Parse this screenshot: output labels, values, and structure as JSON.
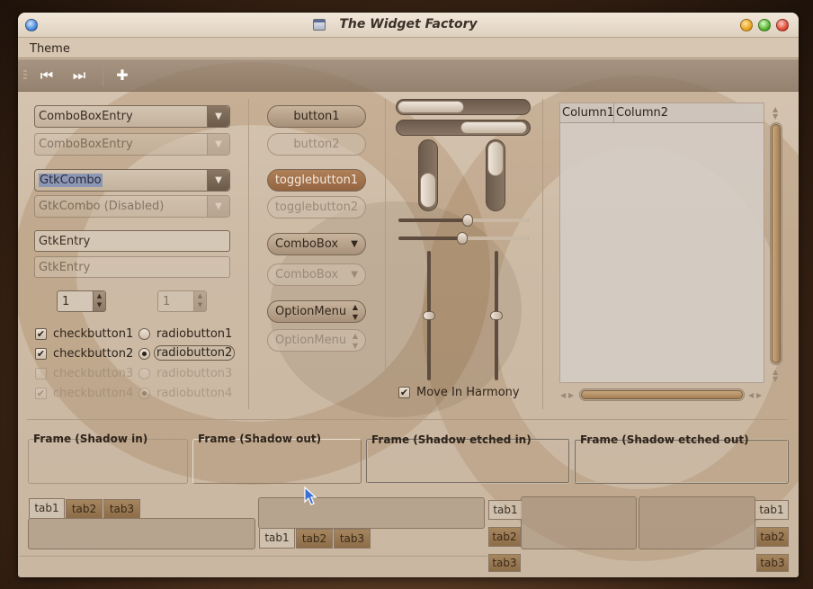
{
  "window": {
    "title": "The Widget Factory"
  },
  "menubar": {
    "items": [
      "Theme"
    ]
  },
  "toolbar": {
    "buttons": [
      {
        "name": "go-first",
        "icon": "go-first-icon",
        "glyph": "⏮"
      },
      {
        "name": "go-last",
        "icon": "go-last-icon",
        "glyph": "⏭"
      },
      {
        "name": "add",
        "icon": "add-icon",
        "glyph": "✚"
      }
    ]
  },
  "column1": {
    "combobox_entry": "ComboBoxEntry",
    "combobox_entry_disabled": "ComboBoxEntry",
    "gtk_combo": "GtkCombo",
    "gtk_combo_disabled": "GtkCombo (Disabled)",
    "gtk_entry": "GtkEntry",
    "gtk_entry_disabled": "GtkEntry",
    "spin_value": "1",
    "spin_value_disabled": "1",
    "checks": [
      {
        "label": "checkbutton1",
        "checked": true,
        "disabled": false
      },
      {
        "label": "checkbutton2",
        "checked": true,
        "disabled": false
      },
      {
        "label": "checkbutton3",
        "checked": false,
        "disabled": true
      },
      {
        "label": "checkbutton4",
        "checked": true,
        "disabled": true
      }
    ],
    "radios": [
      {
        "label": "radiobutton1",
        "selected": false,
        "disabled": false
      },
      {
        "label": "radiobutton2",
        "selected": true,
        "disabled": false
      },
      {
        "label": "radiobutton3",
        "selected": false,
        "disabled": true
      },
      {
        "label": "radiobutton4",
        "selected": true,
        "disabled": true
      }
    ]
  },
  "column2": {
    "button1": "button1",
    "button2": "button2",
    "togglebutton1": "togglebutton1",
    "togglebutton2": "togglebutton2",
    "combobox": "ComboBox",
    "combobox_disabled": "ComboBox",
    "optionmenu": "OptionMenu",
    "optionmenu_disabled": "OptionMenu"
  },
  "column3": {
    "progress_h1": 0.5,
    "progress_h2": 0.5,
    "progress_v1": 0.5,
    "progress_v2": 0.5,
    "scale_h1": 0.53,
    "scale_h2": 0.49,
    "scale_v1": 0.5,
    "scale_v2": 0.5,
    "move_in_harmony": "Move In Harmony",
    "move_in_harmony_checked": true
  },
  "treeview": {
    "columns": [
      "Column1",
      "Column2"
    ]
  },
  "frames": [
    {
      "label": "Frame (Shadow in)"
    },
    {
      "label": "Frame (Shadow out)"
    },
    {
      "label": "Frame (Shadow etched in)"
    },
    {
      "label": "Frame (Shadow etched out)"
    }
  ],
  "notebooks": {
    "tabs": [
      "tab1",
      "tab2",
      "tab3"
    ],
    "active": "tab1"
  },
  "colors": {
    "accent": "#a47e54",
    "selection": "#8c97b6"
  }
}
